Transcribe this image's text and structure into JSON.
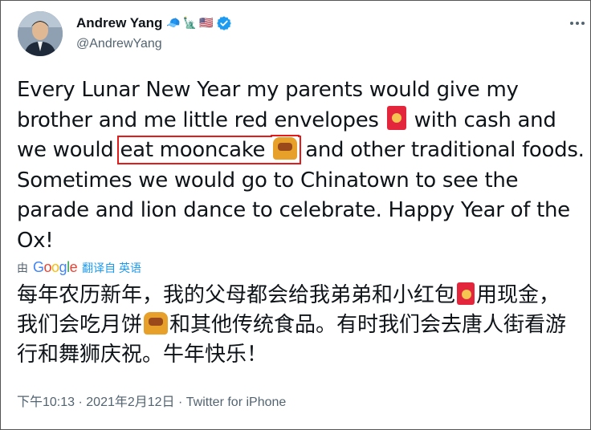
{
  "tweet": {
    "author_name": "Andrew Yang",
    "name_emojis": [
      "🧢",
      "🗽",
      "🇺🇸"
    ],
    "handle": "@AndrewYang",
    "text_before_envelope": "Every Lunar New Year my parents would give my brother and me little red envelopes",
    "text_after_envelope": "with cash and we would",
    "highlighted_text": "eat mooncake",
    "text_after_highlight": "and other traditional foods. Sometimes we would go to Chinatown to see the parade and lion dance to celebrate.  Happy Year of the Ox!"
  },
  "translation": {
    "by_label": "由",
    "provider": "Google",
    "action_label": "翻译自 英语",
    "text_part1": "每年农历新年，我的父母都会给我弟弟和小红包",
    "text_part2": "用现金，我们会吃月饼",
    "text_part3": "和其他传统食品。有时我们会去唐人街看游行和舞狮庆祝。牛年快乐！"
  },
  "meta": {
    "time": "下午10:13",
    "separator1": " · ",
    "date": "2021年2月12日",
    "separator2": " · ",
    "source": "Twitter for iPhone"
  },
  "colors": {
    "highlight_box": "#e31b1b",
    "verified": "#1d9bf0",
    "secondary_text": "#536471",
    "link": "#1d9bf0"
  },
  "icons": {
    "verified": "verified-badge-icon",
    "more": "more-options-icon",
    "envelope": "red-envelope-emoji",
    "mooncake": "mooncake-emoji"
  }
}
